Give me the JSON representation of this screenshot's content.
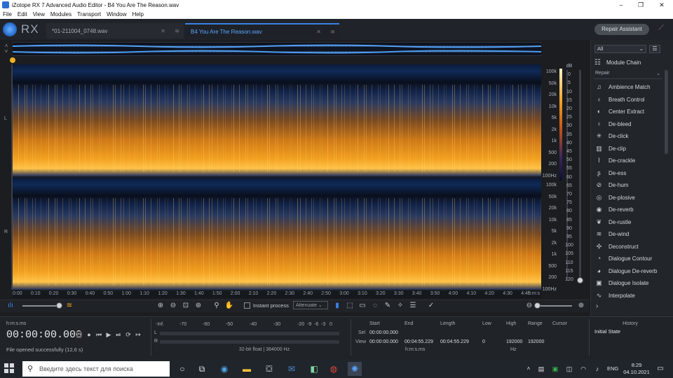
{
  "window": {
    "title": "iZotope RX 7 Advanced Audio Editor - B4 You Are The Reason.wav"
  },
  "menu": [
    "File",
    "Edit",
    "View",
    "Modules",
    "Transport",
    "Window",
    "Help"
  ],
  "logo_text": "RX",
  "tabs": [
    {
      "label": "*01-211004_0748.wav",
      "active": false
    },
    {
      "label": "B4 You Are The Reason.wav",
      "active": true
    }
  ],
  "repair_assistant_label": "Repair Assistant",
  "channels": [
    "L",
    "R"
  ],
  "freq_labels": [
    "100k",
    "50k",
    "20k",
    "10k",
    "5k",
    "2k",
    "1k",
    "500",
    "200",
    "100Hz"
  ],
  "db_labels": [
    "dB",
    "0",
    "5",
    "10",
    "15",
    "20",
    "25",
    "30",
    "35",
    "40",
    "45",
    "50",
    "55",
    "60",
    "65",
    "70",
    "75",
    "80",
    "85",
    "90",
    "95",
    "100",
    "105",
    "110",
    "115",
    "120"
  ],
  "time_labels": [
    "0:00",
    "0:10",
    "0:20",
    "0:30",
    "0:40",
    "0:50",
    "1:00",
    "1:10",
    "1:20",
    "1:30",
    "1:40",
    "1:50",
    "2:00",
    "2:10",
    "2:20",
    "2:30",
    "2:40",
    "2:50",
    "3:00",
    "3:10",
    "3:20",
    "3:30",
    "3:40",
    "3:50",
    "4:00",
    "4:10",
    "4:20",
    "4:30",
    "4:40",
    "h:m:s"
  ],
  "toolbar": {
    "instant_process_label": "Instant process",
    "attenuate_label": "Attenuate"
  },
  "right_panel": {
    "filter_value": "All",
    "module_chain_label": "Module Chain",
    "section_label": "Repair",
    "modules": [
      {
        "label": "Ambience Match",
        "icon": "ambience-match-icon",
        "glyph": "♫"
      },
      {
        "label": "Breath Control",
        "icon": "breath-control-icon",
        "glyph": "♁"
      },
      {
        "label": "Center Extract",
        "icon": "center-extract-icon",
        "glyph": "◐"
      },
      {
        "label": "De-bleed",
        "icon": "de-bleed-icon",
        "glyph": "♀"
      },
      {
        "label": "De-click",
        "icon": "de-click-icon",
        "glyph": "✳"
      },
      {
        "label": "De-clip",
        "icon": "de-clip-icon",
        "glyph": "▥"
      },
      {
        "label": "De-crackle",
        "icon": "de-crackle-icon",
        "glyph": "⌇"
      },
      {
        "label": "De-ess",
        "icon": "de-ess-icon",
        "glyph": "ʂ"
      },
      {
        "label": "De-hum",
        "icon": "de-hum-icon",
        "glyph": "⊘"
      },
      {
        "label": "De-plosive",
        "icon": "de-plosive-icon",
        "glyph": "◎"
      },
      {
        "label": "De-reverb",
        "icon": "de-reverb-icon",
        "glyph": "◉"
      },
      {
        "label": "De-rustle",
        "icon": "de-rustle-icon",
        "glyph": "❦"
      },
      {
        "label": "De-wind",
        "icon": "de-wind-icon",
        "glyph": "≋"
      },
      {
        "label": "Deconstruct",
        "icon": "deconstruct-icon",
        "glyph": "✣"
      },
      {
        "label": "Dialogue Contour",
        "icon": "dialogue-contour-icon",
        "glyph": "◔"
      },
      {
        "label": "Dialogue De-reverb",
        "icon": "dialogue-de-reverb-icon",
        "glyph": "◕"
      },
      {
        "label": "Dialogue Isolate",
        "icon": "dialogue-isolate-icon",
        "glyph": "▣"
      },
      {
        "label": "Interpolate",
        "icon": "interpolate-icon",
        "glyph": "∿"
      }
    ]
  },
  "transport": {
    "time_format": "h:m:s.ms",
    "timecode": "00:00:00.000",
    "status": "File opened successfully (12,6 s)"
  },
  "meter": {
    "scale": [
      "-Inf.",
      "-70",
      "-60",
      "-50",
      "-40",
      "-30",
      "-20",
      "-9",
      "-6",
      "-3",
      "0"
    ],
    "channels": [
      "L",
      "R"
    ],
    "format_info": "32-bit float | 384000 Hz"
  },
  "selection": {
    "headers": [
      "Start",
      "End",
      "Length",
      "Low",
      "High",
      "Range",
      "Cursor"
    ],
    "row_sel_label": "Sel",
    "row_view_label": "View",
    "sel": {
      "start": "00:00:00.000"
    },
    "view": {
      "start": "00:00:00.000",
      "end": "00:04:55.229",
      "length": "00:04:55.229",
      "low": "0",
      "high": "192000",
      "range": "192000"
    },
    "time_unit": "h:m:s.ms",
    "freq_unit": "Hz"
  },
  "history": {
    "label": "History",
    "items": [
      "Initial State"
    ]
  },
  "taskbar": {
    "search_placeholder": "Введите здесь текст для поиска",
    "lang": "ENG",
    "time": "8:29",
    "date": "04.10.2021"
  },
  "colors": {
    "accent": "#3b82e6",
    "spectrogram_hot": "#f2a020",
    "playhead": "#f0b020"
  }
}
